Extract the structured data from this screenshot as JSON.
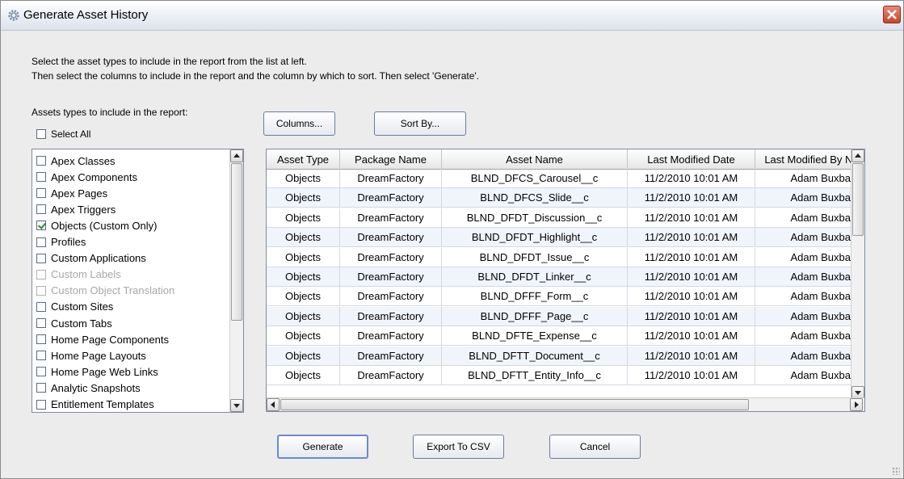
{
  "window": {
    "title": "Generate Asset History"
  },
  "instructions": {
    "line1": "Select the asset types to include in the report from the list at left.",
    "line2": "Then select the columns to include in the report and the column by which to sort. Then select 'Generate'."
  },
  "assets": {
    "label": "Assets types to include in the report:",
    "select_all": "Select All",
    "items": [
      {
        "label": "Apex Classes",
        "checked": false,
        "disabled": false
      },
      {
        "label": "Apex Components",
        "checked": false,
        "disabled": false
      },
      {
        "label": "Apex Pages",
        "checked": false,
        "disabled": false
      },
      {
        "label": "Apex Triggers",
        "checked": false,
        "disabled": false
      },
      {
        "label": "Objects (Custom Only)",
        "checked": true,
        "disabled": false
      },
      {
        "label": "Profiles",
        "checked": false,
        "disabled": false
      },
      {
        "label": "Custom Applications",
        "checked": false,
        "disabled": false
      },
      {
        "label": "Custom Labels",
        "checked": false,
        "disabled": true
      },
      {
        "label": "Custom Object Translation",
        "checked": false,
        "disabled": true
      },
      {
        "label": "Custom Sites",
        "checked": false,
        "disabled": false
      },
      {
        "label": "Custom Tabs",
        "checked": false,
        "disabled": false
      },
      {
        "label": "Home Page Components",
        "checked": false,
        "disabled": false
      },
      {
        "label": "Home Page Layouts",
        "checked": false,
        "disabled": false
      },
      {
        "label": "Home Page Web Links",
        "checked": false,
        "disabled": false
      },
      {
        "label": "Analytic Snapshots",
        "checked": false,
        "disabled": false
      },
      {
        "label": "Entitlement Templates",
        "checked": false,
        "disabled": false
      }
    ]
  },
  "toolbar": {
    "columns_label": "Columns...",
    "sortby_label": "Sort By..."
  },
  "table": {
    "columns": [
      "Asset Type",
      "Package Name",
      "Asset Name",
      "Last Modified Date",
      "Last Modified By Na"
    ],
    "rows": [
      [
        "Objects",
        "DreamFactory",
        "BLND_DFCS_Carousel__c",
        "11/2/2010 10:01 AM",
        "Adam Buxbaum"
      ],
      [
        "Objects",
        "DreamFactory",
        "BLND_DFCS_Slide__c",
        "11/2/2010 10:01 AM",
        "Adam Buxbaum"
      ],
      [
        "Objects",
        "DreamFactory",
        "BLND_DFDT_Discussion__c",
        "11/2/2010 10:01 AM",
        "Adam Buxbaum"
      ],
      [
        "Objects",
        "DreamFactory",
        "BLND_DFDT_Highlight__c",
        "11/2/2010 10:01 AM",
        "Adam Buxbaum"
      ],
      [
        "Objects",
        "DreamFactory",
        "BLND_DFDT_Issue__c",
        "11/2/2010 10:01 AM",
        "Adam Buxbaum"
      ],
      [
        "Objects",
        "DreamFactory",
        "BLND_DFDT_Linker__c",
        "11/2/2010 10:01 AM",
        "Adam Buxbaum"
      ],
      [
        "Objects",
        "DreamFactory",
        "BLND_DFFF_Form__c",
        "11/2/2010 10:01 AM",
        "Adam Buxbaum"
      ],
      [
        "Objects",
        "DreamFactory",
        "BLND_DFFF_Page__c",
        "11/2/2010 10:01 AM",
        "Adam Buxbaum"
      ],
      [
        "Objects",
        "DreamFactory",
        "BLND_DFTE_Expense__c",
        "11/2/2010 10:01 AM",
        "Adam Buxbaum"
      ],
      [
        "Objects",
        "DreamFactory",
        "BLND_DFTT_Document__c",
        "11/2/2010 10:01 AM",
        "Adam Buxbaum"
      ],
      [
        "Objects",
        "DreamFactory",
        "BLND_DFTT_Entity_Info__c",
        "11/2/2010 10:01 AM",
        "Adam Buxbaum"
      ]
    ]
  },
  "actions": {
    "generate": "Generate",
    "export": "Export To CSV",
    "cancel": "Cancel"
  }
}
